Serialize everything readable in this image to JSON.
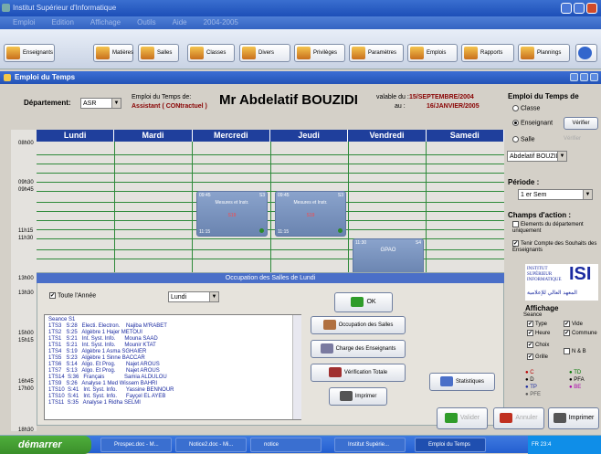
{
  "window": {
    "title": "Institut Supérieur d'Informatique"
  },
  "menu": [
    "Emploi",
    "Edition",
    "Affichage",
    "Outils",
    "Aide",
    "2004-2005"
  ],
  "toolbar": [
    "Enseignants",
    "Matières",
    "Salles",
    "Classes",
    "Divers",
    "Privilèges",
    "Paramètres",
    "Emplois",
    "Rapports",
    "Plannings"
  ],
  "inner_title": "Emploi du Temps",
  "header": {
    "dept_label": "Département:",
    "dept_value": "ASR",
    "emploi_label": "Emploi du Temps de:",
    "role": "Assistant ( CONtractuel )",
    "teacher": "Mr Abdelatif BOUZIDI",
    "valid_label": "valable du :",
    "valid_from": "15/SEPTEMBRE/2004",
    "valid_au": "au :",
    "valid_to": "16/JANVIER/2005"
  },
  "days": [
    "Lundi",
    "Mardi",
    "Mercredi",
    "Jeudi",
    "Vendredi",
    "Samedi"
  ],
  "times": [
    "08h00",
    "09h30",
    "09h45",
    "11h15",
    "11h30",
    "13h00",
    "13h30",
    "15h00",
    "15h15",
    "16h45",
    "17h00",
    "18h30"
  ],
  "cards": [
    {
      "start": "09:45",
      "end": "11:15",
      "room": "S3",
      "title": "Mesures et Instr.",
      "num": "S19"
    },
    {
      "start": "09:45",
      "end": "11:15",
      "room": "S3",
      "title": "Mesures et Instr.",
      "num": "S19"
    },
    {
      "start": "11:30",
      "end": "",
      "room": "S4",
      "title": "GPAO",
      "num": ""
    }
  ],
  "occupation": {
    "title": "Occupation des Salles de Lundi",
    "toute_annee": "Toute l'Année",
    "day_select": "Lundi",
    "seance": "Seance S1",
    "rows": [
      "1TS3   S:28   Electi. Electron.    Najiba M'RABET",
      "1TS2   S:25   Algèbre 1 Hajer METOUI",
      "1TS1   S:21   Int. Syst. Info.      Mouna SAAD",
      "1TS1   S:21   Int. Syst. Info.      Mounir KTAT",
      "1TS4   S:19   Algèbre 1 Asma SGHAIER",
      "1TS5   S:23   Algèbre 1 Sinne BACCAR",
      "1TS6   S:14   Algo. Et Prog.       Najet AROUS",
      "1TS7   S:13   Algo. Et Prog.       Najet AROUS",
      "1TS14  S:36   Français             Samia ALDULOU",
      "1TS9   S:26   Analyse 1 Med Wissem BAHRI",
      "1TS10  S:41   Int. Syst. Info.      Yassine BENNOUR",
      "1TS10  S:41   Int. Syst. Info.      Fayçel EL AYEB",
      "1TS11  S:35   Analyse 1 Ridha SELMI"
    ],
    "ok": "OK",
    "btn_occ": "Occupation des Salles",
    "btn_charge": "Charge des Enseignants",
    "btn_verif": "Vérification Totale",
    "btn_print": "Imprimer",
    "btn_stats": "Statistiques"
  },
  "sidebar": {
    "title": "Emploi du Temps de",
    "opt_classe": "Classe",
    "opt_ens": "Enseignant",
    "opt_salle": "Salle",
    "verifier": "Vérifier",
    "teacher_select": "Abdelatif BOUZIDI",
    "periode_label": "Période :",
    "periode_value": "1 er Sem",
    "champs_label": "Champs d'action :",
    "champ1": "Elements du département uniquement",
    "champ2": "Tenir Compte des Souhaits des Enseignants",
    "logo_lines": [
      "INSTITUT",
      "SUPÉRIEUR",
      "INFORMATIQUE"
    ],
    "logo_mark": "ISI",
    "logo_arabic": "المعهد العالي للإعلامية",
    "affichage": "Affichage",
    "seance": "Seance",
    "opts": [
      "Type",
      "Vide",
      "Heure",
      "Commune",
      "Choix",
      "Grille",
      "N & B"
    ],
    "legend": [
      "C",
      "TD",
      "D",
      "PFA",
      "TP",
      "BE",
      "PFE"
    ]
  },
  "footer": {
    "valider": "Valider",
    "annuler": "Annuler",
    "imprimer": "Imprimer"
  },
  "taskbar": {
    "start": "démarrer",
    "tasks": [
      "Prospec.doc - M...",
      "Notice2.doc - Mi...",
      "notice",
      "Institut Supérie...",
      "Emploi du Temps"
    ],
    "tray": "FR 23:4"
  },
  "colors": {
    "title": "#1d4fb8",
    "grid": "#2e8a3a",
    "dayhdr": "#1f3f9c"
  }
}
